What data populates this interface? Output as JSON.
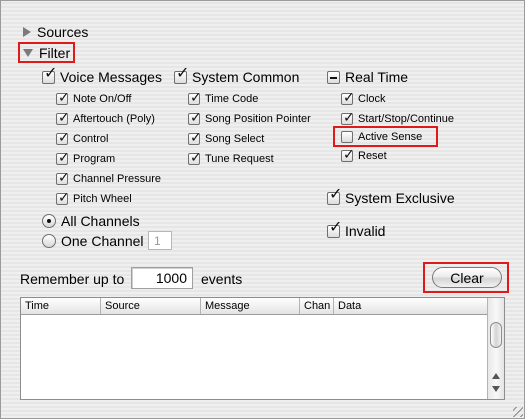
{
  "sources": {
    "label": "Sources"
  },
  "filter": {
    "label": "Filter",
    "voice_messages": {
      "label": "Voice Messages",
      "items": [
        "Note On/Off",
        "Aftertouch (Poly)",
        "Control",
        "Program",
        "Channel Pressure",
        "Pitch Wheel"
      ]
    },
    "system_common": {
      "label": "System Common",
      "items": [
        "Time Code",
        "Song Position Pointer",
        "Song Select",
        "Tune Request"
      ]
    },
    "real_time": {
      "label": "Real Time",
      "items": [
        "Clock",
        "Start/Stop/Continue",
        "Active Sense",
        "Reset"
      ]
    },
    "system_exclusive": {
      "label": "System Exclusive"
    },
    "invalid": {
      "label": "Invalid"
    },
    "channels": {
      "all": "All Channels",
      "one": "One Channel",
      "selected_channel": "1"
    }
  },
  "remember": {
    "prefix": "Remember up to",
    "value": "1000",
    "suffix": "events"
  },
  "clear_button": {
    "label": "Clear"
  },
  "log": {
    "columns": [
      "Time",
      "Source",
      "Message",
      "Chan",
      "Data"
    ]
  },
  "colors": {
    "highlight": "#e01a1a",
    "background": "#ececec",
    "table_background": "#ffffff"
  }
}
